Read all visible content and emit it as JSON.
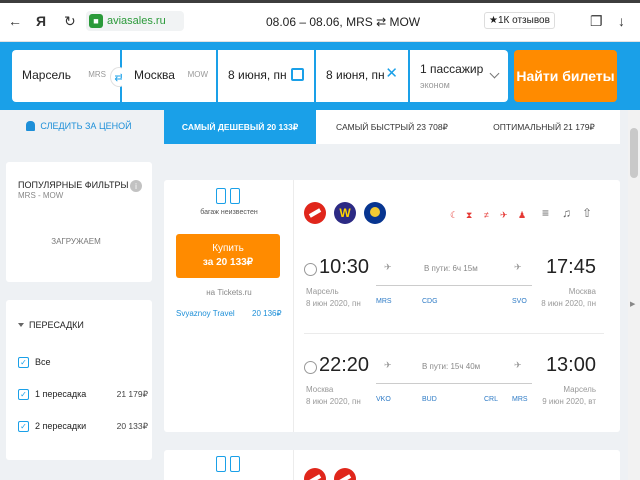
{
  "browser": {
    "url": "aviasales.ru",
    "page_title": "08.06 – 08.06, MRS ⇄ MOW",
    "reviews_badge": "★1К отзывов"
  },
  "search": {
    "origin": "Марсель",
    "origin_iata": "MRS",
    "destination": "Москва",
    "destination_iata": "MOW",
    "depart_date": "8 июня, пн",
    "return_date": "8 июня, пн",
    "passengers": "1 пассажир",
    "cabin_class": "эконом",
    "submit_label": "Найти билеты"
  },
  "price_alert_label": "СЛЕДИТЬ ЗА ЦЕНОЙ",
  "sort_tabs": [
    {
      "label": "САМЫЙ ДЕШЕВЫЙ 20 133₽",
      "active": true
    },
    {
      "label": "САМЫЙ БЫСТРЫЙ 23 708₽",
      "active": false
    },
    {
      "label": "ОПТИМАЛЬНЫЙ 21 179₽",
      "active": false
    }
  ],
  "popular_filters": {
    "title": "ПОПУЛЯРНЫЕ ФИЛЬТРЫ",
    "route": "MRS - MOW",
    "loading_text": "ЗАГРУЖАЕМ"
  },
  "transfers": {
    "title": "ПЕРЕСАДКИ",
    "options": [
      {
        "label": "Все",
        "price": "",
        "checked": true
      },
      {
        "label": "1 пересадка",
        "price": "21 179₽",
        "checked": true
      },
      {
        "label": "2 пересадки",
        "price": "20 133₽",
        "checked": true
      }
    ]
  },
  "ticket": {
    "baggage_text": "багаж неизвестен",
    "buy_label": "Купить",
    "buy_price": "за 20 133₽",
    "seller": "на Tickets.ru",
    "agency": "Svyaznoy Travel",
    "agency_price": "20 136₽",
    "segments": [
      {
        "dep_time": "10:30",
        "arr_time": "17:45",
        "duration": "В пути: 6ч 15м",
        "dep_city": "Марсель",
        "dep_date": "8 июн 2020, пн",
        "arr_city": "Москва",
        "arr_date": "8 июн 2020, пн",
        "codes": [
          "MRS",
          "CDG",
          "SVO"
        ]
      },
      {
        "dep_time": "22:20",
        "arr_time": "13:00",
        "duration": "В пути: 15ч 40м",
        "dep_city": "Москва",
        "dep_date": "8 июн 2020, пн",
        "arr_city": "Марсель",
        "arr_date": "9 июн 2020, вт",
        "codes": [
          "VKO",
          "BUD",
          "CRL",
          "MRS"
        ]
      }
    ]
  },
  "colors": {
    "brand_blue": "#1aa0e8",
    "cta_orange": "#ff8b00",
    "link_blue": "#1d8fd8"
  }
}
